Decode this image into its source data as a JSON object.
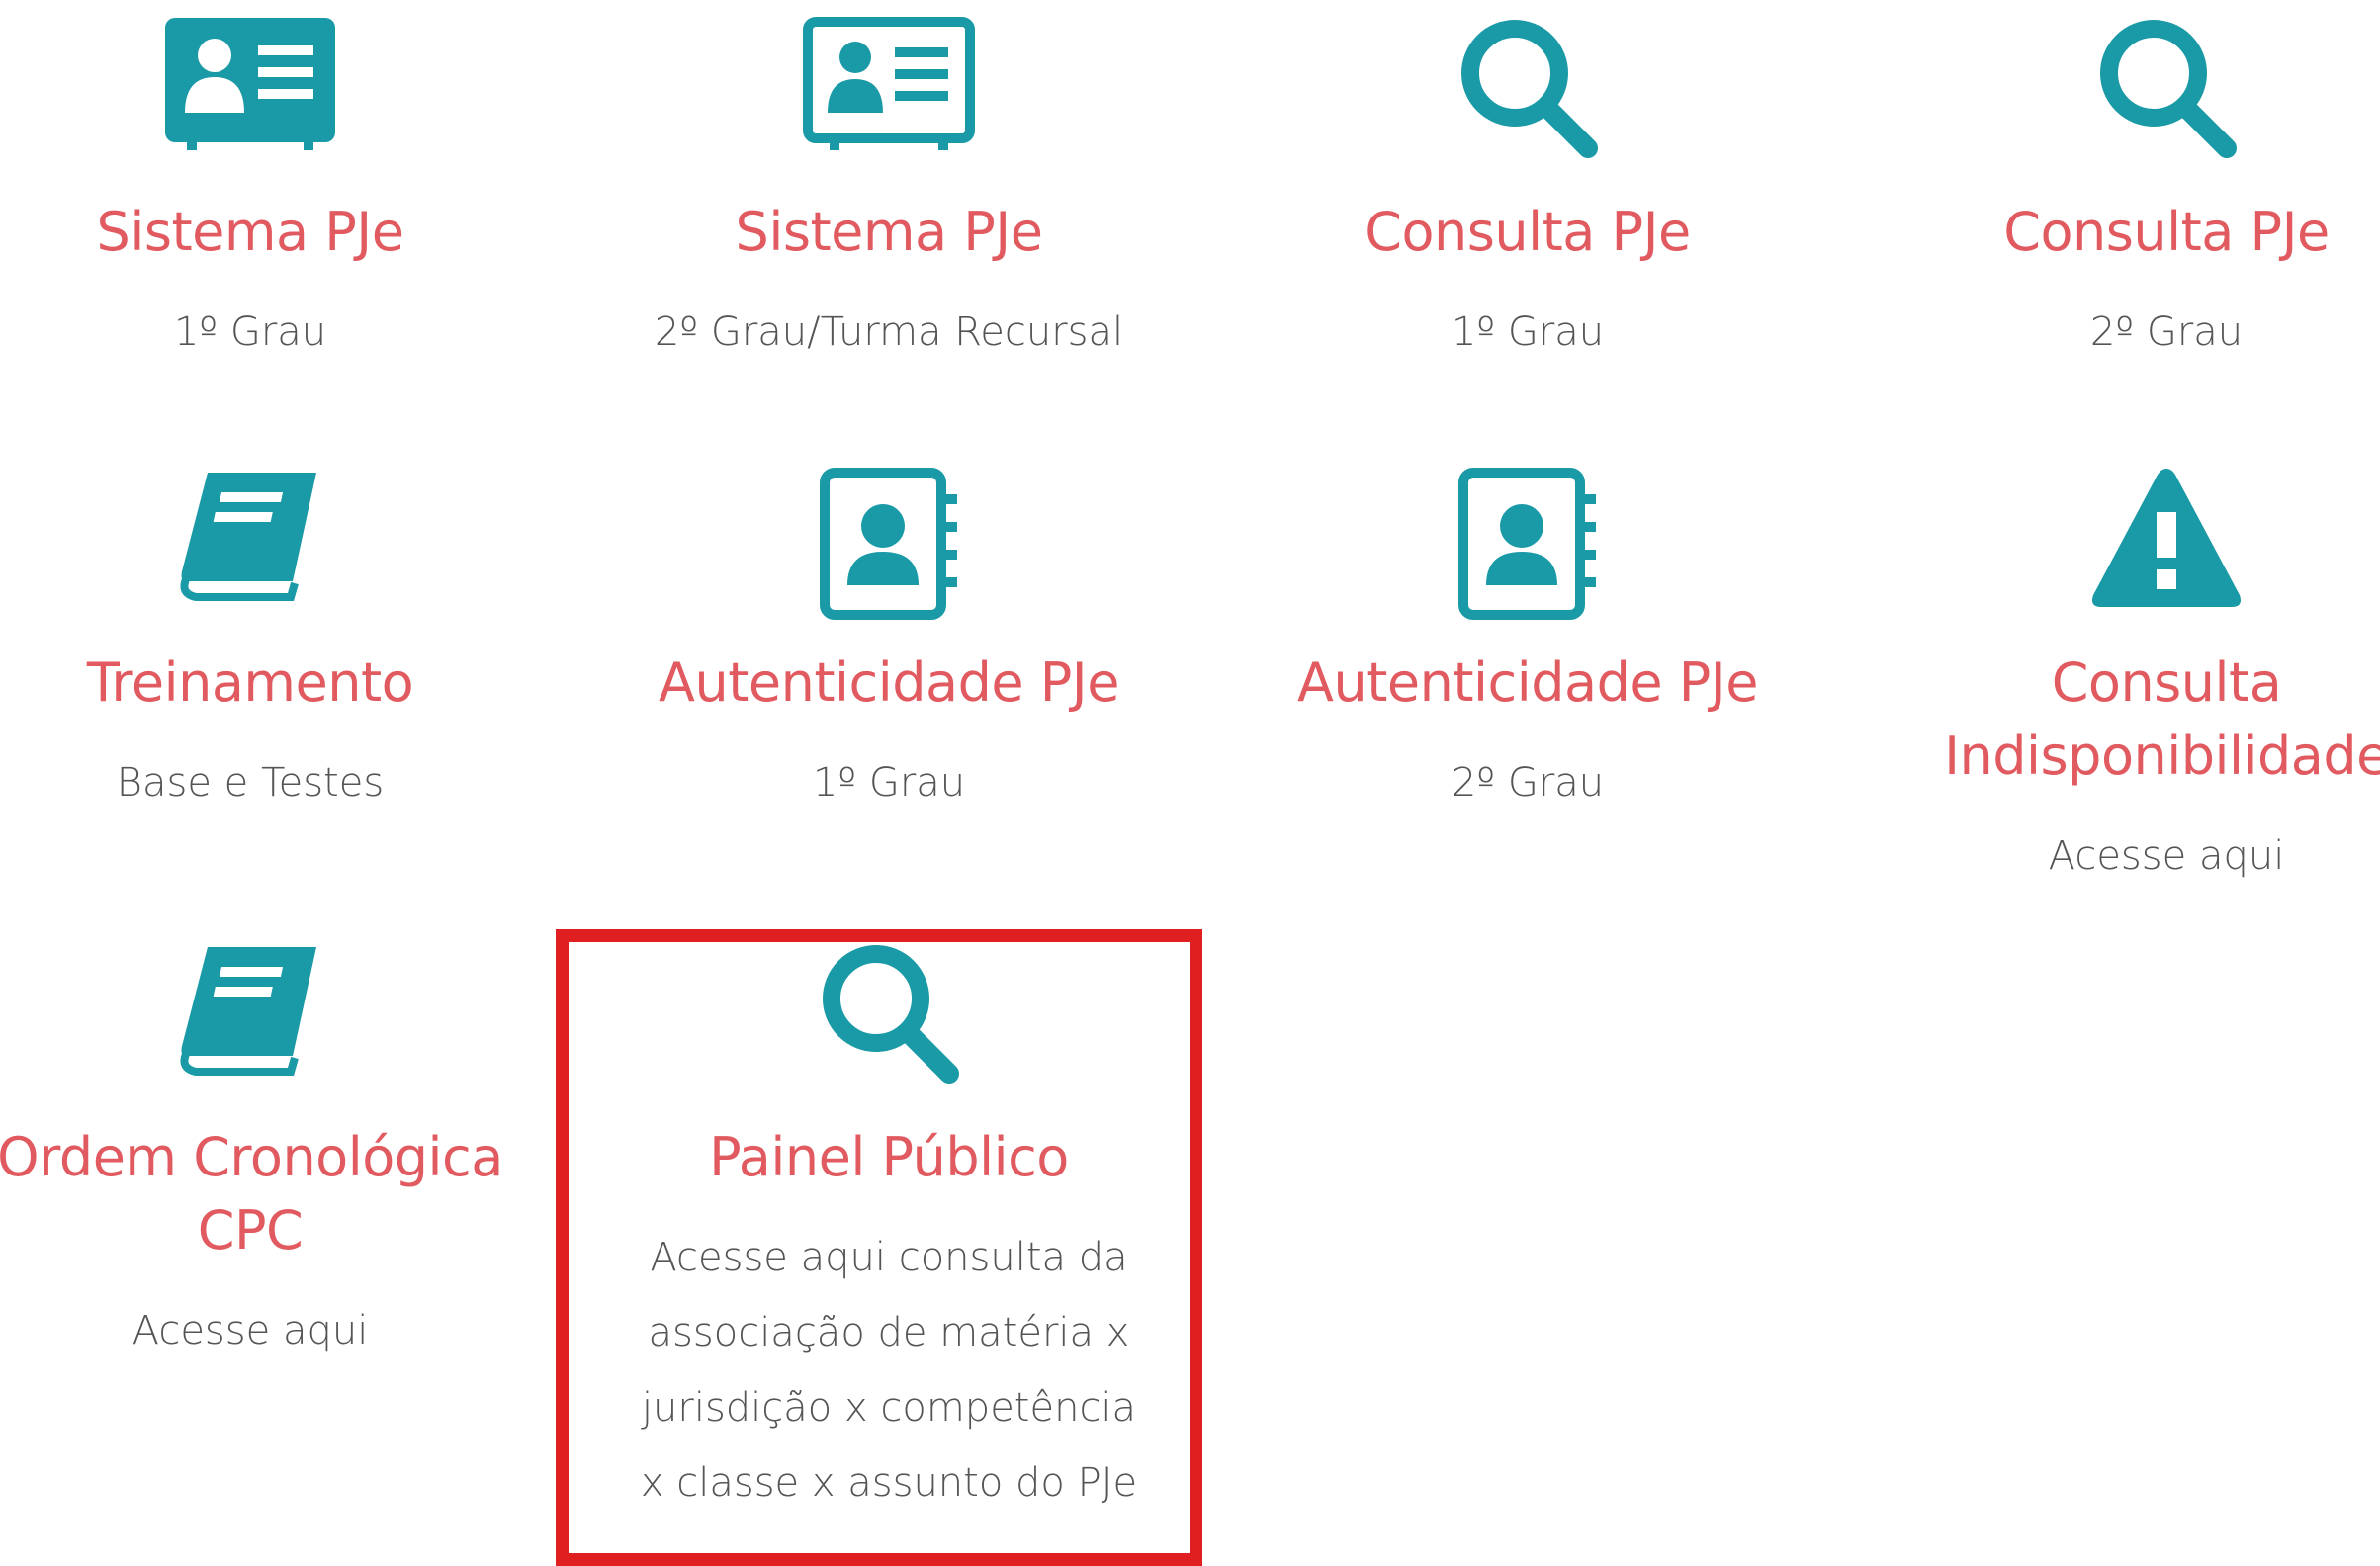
{
  "tiles": [
    {
      "id": "sistema-pje-1",
      "icon": "id-card-icon",
      "title": "Sistema PJe",
      "subtitle": "1º Grau"
    },
    {
      "id": "sistema-pje-2",
      "icon": "id-card-outline-icon",
      "title": "Sistema PJe",
      "subtitle": "2º Grau/Turma Recursal"
    },
    {
      "id": "consulta-pje-1",
      "icon": "search-icon",
      "title": "Consulta PJe",
      "subtitle": "1º Grau"
    },
    {
      "id": "consulta-pje-2",
      "icon": "search-icon",
      "title": "Consulta PJe",
      "subtitle": "2º Grau"
    },
    {
      "id": "treinamento",
      "icon": "book-icon",
      "title": "Treinamento",
      "subtitle": "Base e Testes"
    },
    {
      "id": "autenticidade-pje-1",
      "icon": "address-book-icon",
      "title": "Autenticidade PJe",
      "subtitle": "1º Grau"
    },
    {
      "id": "autenticidade-pje-2",
      "icon": "address-book-icon",
      "title": "Autenticidade PJe",
      "subtitle": "2º Grau"
    },
    {
      "id": "consulta-indisponibilidade",
      "icon": "warning-icon",
      "title_line1": "Consulta",
      "title_line2": "Indisponibilidade",
      "subtitle": "Acesse aqui"
    },
    {
      "id": "ordem-cronologica",
      "icon": "book-icon",
      "title_line1": "Ordem Cronológica",
      "title_line2": "CPC",
      "subtitle": "Acesse aqui"
    },
    {
      "id": "painel-publico",
      "icon": "search-icon",
      "title": "Painel Público",
      "subtitle_lines": [
        "Acesse aqui consulta da",
        "associação de matéria x",
        "jurisdição x competência",
        "x classe x assunto do PJe"
      ]
    }
  ],
  "colors": {
    "icon": "#1a9aa6",
    "title": "#e05a5f",
    "subtitle": "#555555",
    "highlight": "#e02020"
  }
}
